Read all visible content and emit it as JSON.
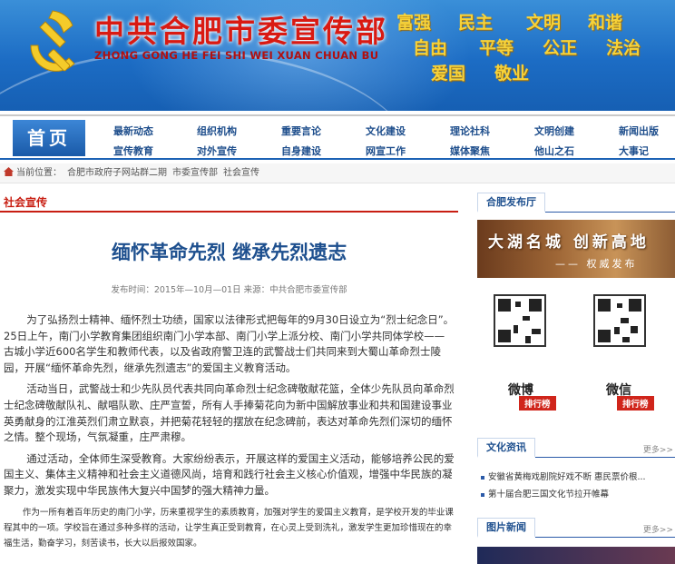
{
  "header": {
    "title": "中共合肥市委宣传部",
    "subtitle": "ZHONG GONG HE FEI SHI WEI XUAN CHUAN BU",
    "values": [
      "富强",
      "民主",
      "文明",
      "和谐",
      "自由",
      "平等",
      "公正",
      "法治",
      "爱国",
      "敬业"
    ]
  },
  "nav": {
    "home": "首页",
    "row1": [
      "最新动态",
      "组织机构",
      "重要言论",
      "文化建设",
      "理论社科",
      "文明创建",
      "新闻出版"
    ],
    "row2": [
      "宣传教育",
      "对外宣传",
      "自身建设",
      "网宣工作",
      "媒体聚焦",
      "他山之石",
      "大事记"
    ]
  },
  "breadcrumb": {
    "label": "当前位置：",
    "items": [
      "合肥市政府子网站群二期",
      "市委宣传部",
      "社会宣传"
    ]
  },
  "article": {
    "section": "社会宣传",
    "title": "缅怀革命先烈 继承先烈遗志",
    "meta": "发布时间：2015年—10月—01日  来源：中共合肥市委宣传部",
    "p1": "为了弘扬烈士精神、缅怀烈士功绩，国家以法律形式把每年的9月30日设立为“烈士纪念日”。25日上午，南门小学教育集团组织南门小学本部、南门小学上派分校、南门小学共同体学校——古城小学近600名学生和教师代表，以及省政府警卫连的武警战士们共同来到大蜀山革命烈士陵园，开展“缅怀革命先烈，继承先烈遗志”的爱国主义教育活动。",
    "p2": "活动当日，武警战士和少先队员代表共同向革命烈士纪念碑敬献花篮，全体少先队员向革命烈士纪念碑敬献队礼、献唱队歌、庄严宣誓，所有人手捧菊花向为新中国解放事业和共和国建设事业英勇献身的江淮英烈们肃立默哀，并把菊花轻轻的摆放在纪念碑前，表达对革命先烈们深切的缅怀之情。整个现场，气氛凝重，庄严肃穆。",
    "p3": "通过活动，全体师生深受教育。大家纷纷表示，开展这样的爱国主义活动，能够培养公民的爱国主义、集体主义精神和社会主义道德风尚，培育和践行社会主义核心价值观，增强中华民族的凝聚力，激发实现中华民族伟大复兴中国梦的强大精神力量。",
    "p4": "作为一所有着百年历史的南门小学，历来重视学生的素质教育，加强对学生的爱国主义教育，是学校开发的毕业课程其中的一项。学校旨在通过多种多样的活动，让学生真正受到教育，在心灵上受到洗礼，激发学生更加珍惜现在的幸福生活，勤奋学习，刻苦读书，长大以后报效国家。"
  },
  "sidebar": {
    "release_title": "合肥发布厅",
    "banner_main": "大湖名城 创新高地",
    "banner_sub": "—— 权威发布",
    "weibo": "微博",
    "weixin": "微信",
    "rank": "排行榜",
    "culture_title": "文化资讯",
    "more": "更多>>",
    "culture_items": [
      "安徽省黄梅戏剧院好戏不断 惠民票价根...",
      "第十届合肥三国文化节拉开帷幕"
    ],
    "pic_title": "图片新闻"
  },
  "colors": {
    "brand_red": "#d91a12",
    "nav_blue": "#1e4e8c",
    "header_blue": "#1c6cc4",
    "value_gold": "#f6d23a"
  }
}
